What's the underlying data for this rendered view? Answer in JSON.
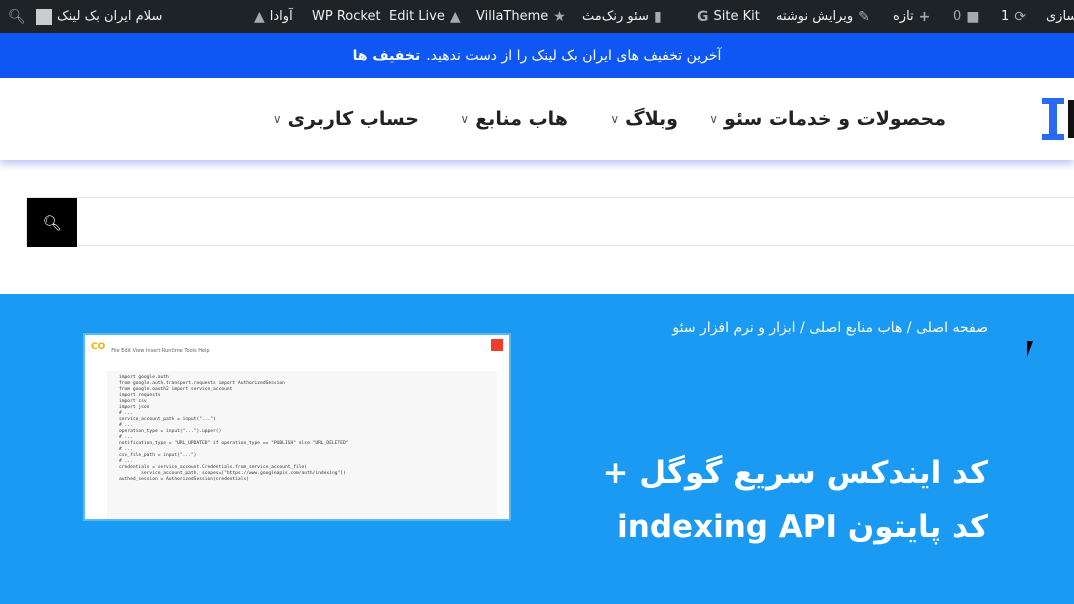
{
  "admin_bar": {
    "greeting": "سلام ایران بک لینک",
    "items": [
      "آوادا",
      "WP Rocket",
      "Edit Live",
      "VillaTheme",
      "سئو رنک‌مث",
      "Site Kit",
      "ویرایش نوشته",
      "تازه",
      "0",
      "1",
      "سازی"
    ]
  },
  "notice": {
    "text": "آخرین تخفیف های ایران بک لینک را از دست ندهید.",
    "link": "تخفیف ها"
  },
  "nav": {
    "items": [
      "محصولات و خدمات سئو",
      "وبلاگ",
      "هاب منابع",
      "حساب کاربری"
    ]
  },
  "search": {
    "placeholder": ""
  },
  "hero": {
    "breadcrumb": "صفحه اصلی / هاب منابع اصلی / ابزار و نرم افزار سئو",
    "title": "کد ایندکس سریع گوگل + کد پایتون indexing API",
    "image": {
      "logo": "CO",
      "menu": "File  Edit  View  Insert  Runtime  Tools  Help",
      "code": [
        "import google.auth",
        "from google.auth.transport.requests import AuthorizedSession",
        "from google.oauth2 import service_account",
        "import requests",
        "import csv",
        "import json",
        "",
        "# ...",
        "service_account_path = input(\"...\")",
        "",
        "# ...",
        "operation_type = input(\"...\").upper()",
        "",
        "# ...",
        "notification_type = \"URL_UPDATED\" if operation_type == \"PUBLISH\" else \"URL_DELETED\"",
        "",
        "# ...",
        "csv_file_path = input(\"...\")",
        "",
        "# ...",
        "credentials = service_account.Credentials.from_service_account_file(",
        "        service_account_path, scopes=[\"https://www.googleapis.com/auth/indexing\"])",
        "authed_session = AuthorizedSession(credentials)"
      ]
    }
  }
}
